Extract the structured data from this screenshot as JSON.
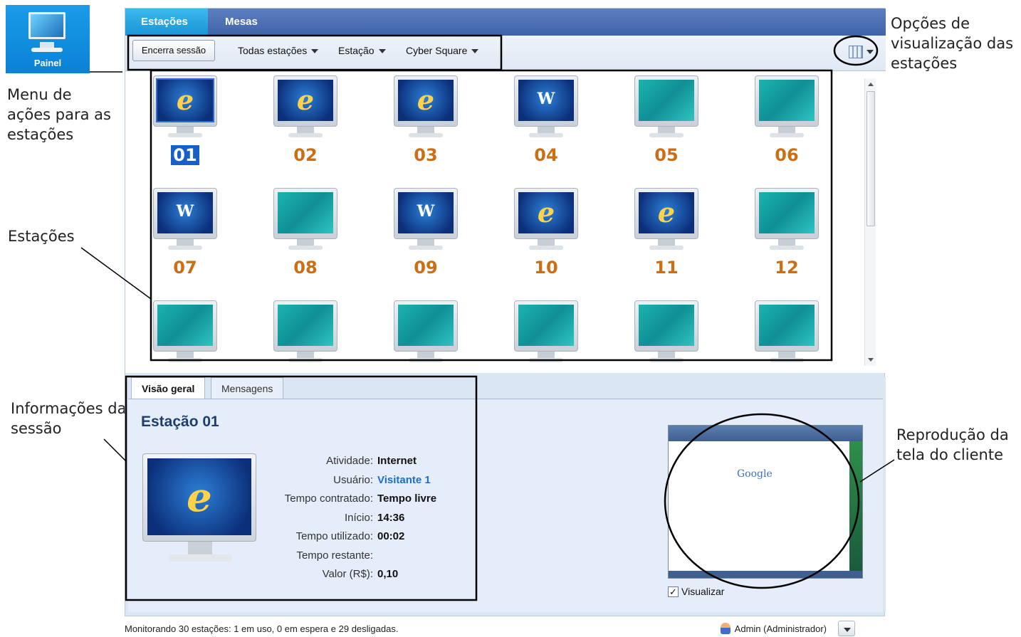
{
  "painel": {
    "label": "Painel"
  },
  "annotations": {
    "menu_acoes": "Menu de\nações para as\nestações",
    "estacoes": "Estações",
    "informacoes": "Informações da\nsessão",
    "opcoes": "Opções de\nvisualização das\nestações",
    "reproducao": "Reprodução da\ntela do cliente"
  },
  "tabs": [
    "Estações",
    "Mesas"
  ],
  "toolbar": {
    "encerra_label": "Encerra sessão",
    "filters": [
      "Todas estações",
      "Estação",
      "Cyber Square"
    ]
  },
  "stations": [
    {
      "num": "01",
      "screen": "ie",
      "selected": true
    },
    {
      "num": "02",
      "screen": "ie"
    },
    {
      "num": "03",
      "screen": "ie"
    },
    {
      "num": "04",
      "screen": "word"
    },
    {
      "num": "05",
      "screen": "off"
    },
    {
      "num": "06",
      "screen": "off"
    },
    {
      "num": "07",
      "screen": "word"
    },
    {
      "num": "08",
      "screen": "off"
    },
    {
      "num": "09",
      "screen": "word"
    },
    {
      "num": "10",
      "screen": "ie"
    },
    {
      "num": "11",
      "screen": "ie"
    },
    {
      "num": "12",
      "screen": "off"
    },
    {
      "num": "",
      "screen": "off"
    },
    {
      "num": "",
      "screen": "off"
    },
    {
      "num": "",
      "screen": "off"
    },
    {
      "num": "",
      "screen": "off"
    },
    {
      "num": "",
      "screen": "off"
    },
    {
      "num": "",
      "screen": "off"
    }
  ],
  "info": {
    "tabs": [
      "Visão geral",
      "Mensagens"
    ],
    "title": "Estação 01",
    "fields": [
      {
        "label": "Atividade:",
        "value": "Internet"
      },
      {
        "label": "Usuário:",
        "value": "Visitante 1",
        "link": true
      },
      {
        "label": "Tempo contratado:",
        "value": "Tempo livre"
      },
      {
        "label": "Início:",
        "value": "14:36"
      },
      {
        "label": "Tempo utilizado:",
        "value": "00:02"
      },
      {
        "label": "Tempo restante:",
        "value": ""
      },
      {
        "label": "Valor (R$):",
        "value": "0,10"
      }
    ],
    "preview_brand": "Google",
    "visualizar_label": "Visualizar",
    "visualizar_checked": true
  },
  "status": {
    "text": "Monitorando 30 estações: 1 em uso, 0 em espera e 29 desligadas.",
    "user": "Admin (Administrador)"
  },
  "colors": {
    "tab_active": "#1795d6",
    "station_number": "#cc6e14",
    "link": "#1b6fc8"
  }
}
